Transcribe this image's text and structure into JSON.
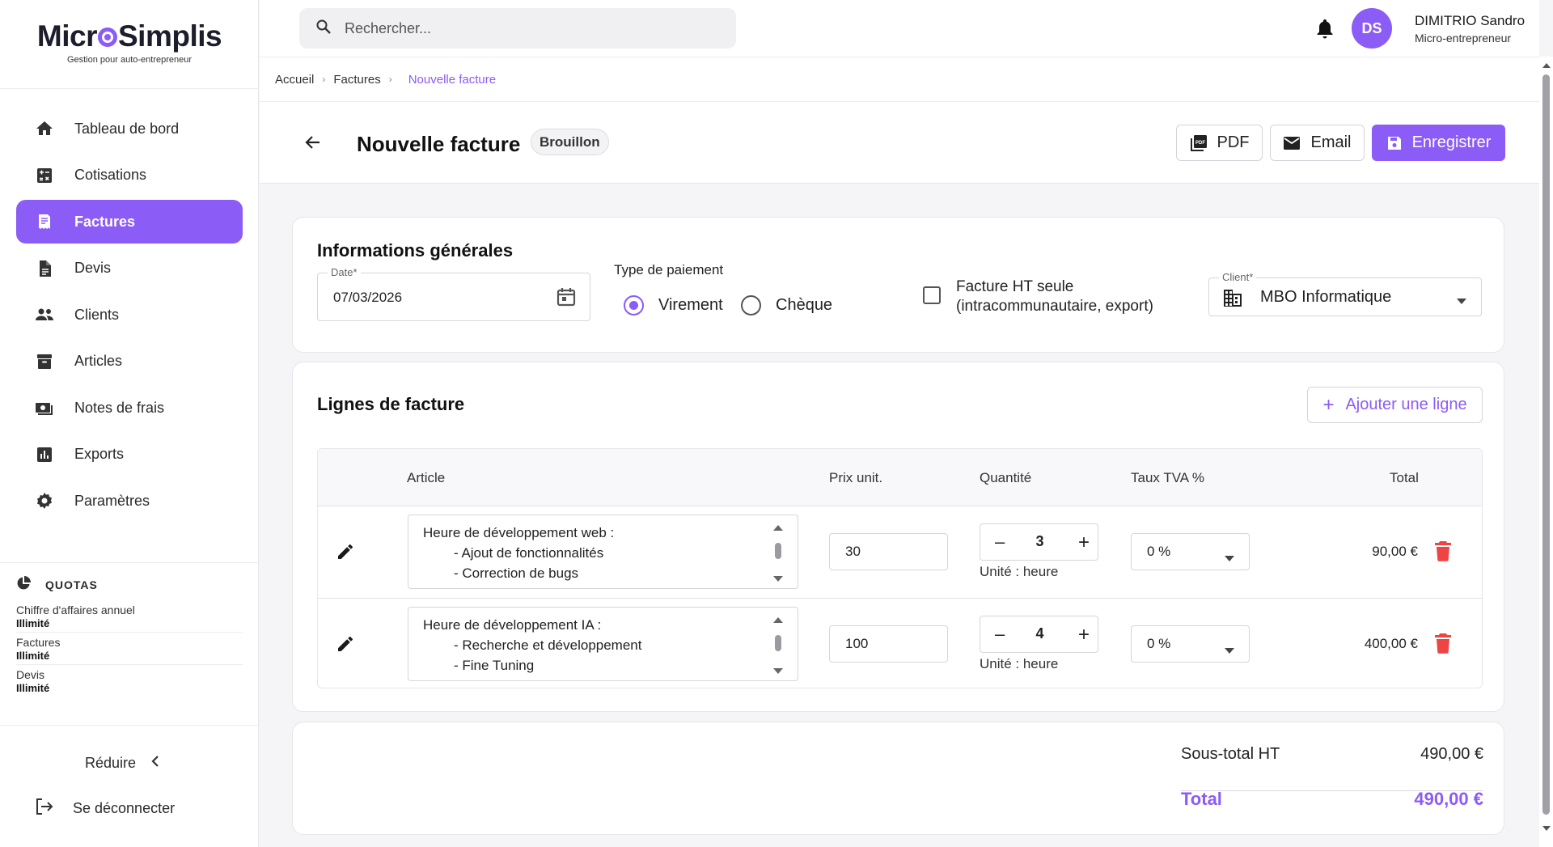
{
  "brand": {
    "name_left": "Micr",
    "name_right": "Simplis",
    "tagline": "Gestion pour auto-entrepreneur",
    "accent": "#8b5cf6"
  },
  "sidebar": {
    "items": [
      {
        "label": "Tableau de bord",
        "icon": "home-icon"
      },
      {
        "label": "Cotisations",
        "icon": "calculator-icon"
      },
      {
        "label": "Factures",
        "icon": "invoice-icon",
        "active": true
      },
      {
        "label": "Devis",
        "icon": "document-icon"
      },
      {
        "label": "Clients",
        "icon": "people-icon"
      },
      {
        "label": "Articles",
        "icon": "archive-icon"
      },
      {
        "label": "Notes de frais",
        "icon": "money-icon"
      },
      {
        "label": "Exports",
        "icon": "chart-icon"
      },
      {
        "label": "Paramètres",
        "icon": "gear-icon"
      }
    ],
    "quotas": {
      "title": "QUOTAS",
      "items": [
        {
          "label": "Chiffre d'affaires annuel",
          "value": "Illimité"
        },
        {
          "label": "Factures",
          "value": "Illimité"
        },
        {
          "label": "Devis",
          "value": "Illimité"
        }
      ]
    },
    "reduce_label": "Réduire",
    "logout_label": "Se déconnecter"
  },
  "topbar": {
    "search_placeholder": "Rechercher...",
    "avatar_initials": "DS",
    "user_name": "DIMITRIO Sandro",
    "user_role": "Micro-entrepreneur"
  },
  "breadcrumb": {
    "home": "Accueil",
    "section": "Factures",
    "current": "Nouvelle facture"
  },
  "header": {
    "title": "Nouvelle facture",
    "status": "Brouillon",
    "pdf_label": "PDF",
    "email_label": "Email",
    "save_label": "Enregistrer"
  },
  "general": {
    "title": "Informations générales",
    "date_label": "Date*",
    "date_value": "07/03/2026",
    "payment_label": "Type de paiement",
    "payment_options": [
      "Virement",
      "Chèque"
    ],
    "payment_selected": "Virement",
    "ht_only_line1": "Facture HT seule",
    "ht_only_line2": "(intracommunautaire, export)",
    "ht_only_checked": false,
    "client_label": "Client*",
    "client_value": "MBO Informatique"
  },
  "lines": {
    "title": "Lignes de facture",
    "add_label": "Ajouter une ligne",
    "columns": {
      "article": "Article",
      "price": "Prix unit.",
      "qty": "Quantité",
      "tva": "Taux TVA %",
      "total": "Total"
    },
    "rows": [
      {
        "desc_title": "Heure de développement web :",
        "desc_items": [
          "- Ajout de fonctionnalités",
          "- Correction de bugs"
        ],
        "price": "30",
        "qty": "3",
        "unit": "Unité : heure",
        "tva": "0 %",
        "total": "90,00 €"
      },
      {
        "desc_title": "Heure de développement IA :",
        "desc_items": [
          "- Recherche et développement",
          "- Fine Tuning"
        ],
        "price": "100",
        "qty": "4",
        "unit": "Unité : heure",
        "tva": "0 %",
        "total": "400,00 €"
      }
    ]
  },
  "totals": {
    "subtotal_label": "Sous-total HT",
    "subtotal_value": "490,00 €",
    "total_label": "Total",
    "total_value": "490,00 €"
  }
}
